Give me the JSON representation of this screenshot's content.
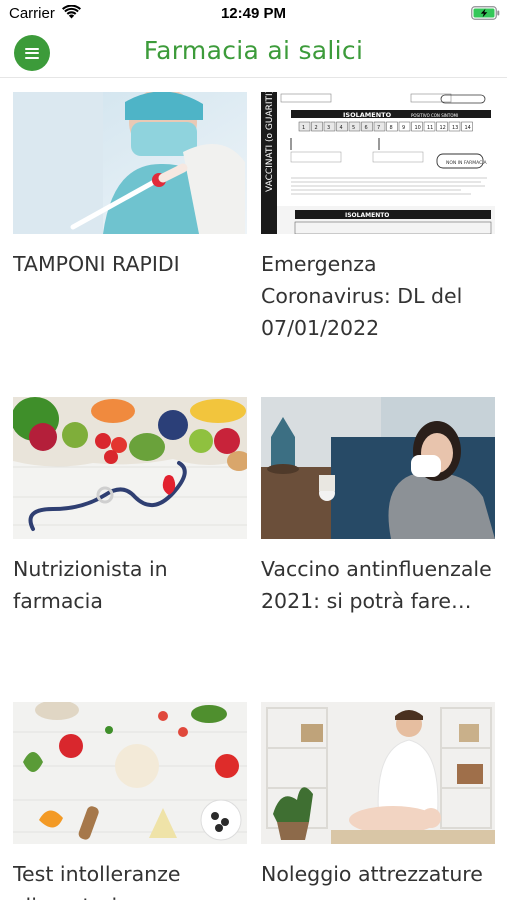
{
  "status_bar": {
    "carrier": "Carrier",
    "time": "12:49 PM",
    "battery_color": "#34c759"
  },
  "header": {
    "title": "Farmacia ai salici",
    "menu_icon": "hamburger-menu-icon",
    "accent": "#3c9b3a"
  },
  "posts": [
    {
      "title": "TAMPONI RAPIDI",
      "image": "rapid-test-swab-photo"
    },
    {
      "title": "Emergenza Coronavirus: DL del 07/01/2022",
      "image": "isolation-table-document"
    },
    {
      "title": "Nutrizionista in farmacia",
      "image": "fruit-vegetables-stethoscope-photo"
    },
    {
      "title": "Vaccino antinfluenzale 2021: si potrà fare…",
      "image": "woman-with-flu-photo"
    },
    {
      "title": "Test intolleranze alimentari",
      "image": "food-ingredients-photo"
    },
    {
      "title": "Noleggio attrezzature",
      "image": "doctor-with-baby-photo"
    }
  ],
  "document_thumb": {
    "side_label": "VACCINATI (o GUARITI)",
    "row_title": "ISOLAMENTO",
    "header_right": "POSITIVO CON SINTOMI",
    "days": [
      "1",
      "2",
      "3",
      "4",
      "5",
      "6",
      "7",
      "8",
      "9",
      "10",
      "11",
      "12",
      "13",
      "14"
    ],
    "badge": "NON IN FARMACIA"
  }
}
